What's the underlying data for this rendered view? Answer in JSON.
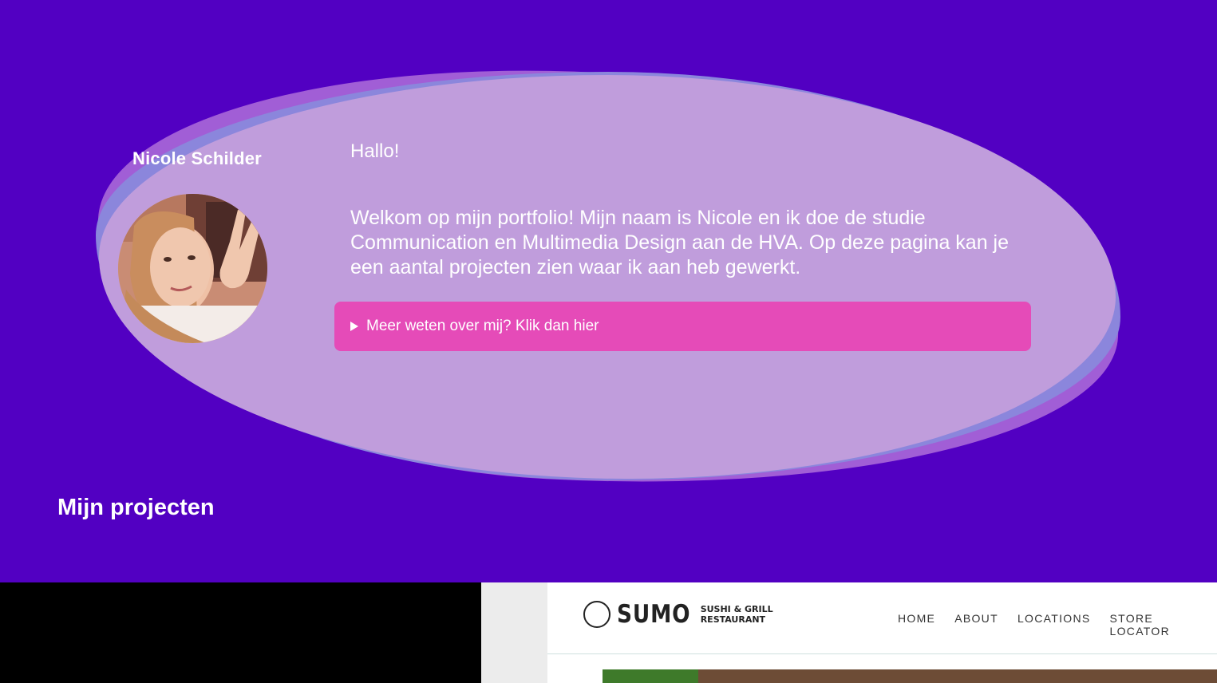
{
  "profile": {
    "name": "Nicole Schilder"
  },
  "intro": {
    "greeting": "Hallo!",
    "text": "Welkom op mijn portfolio! Mijn naam is Nicole en ik doe de studie Communication en Multimedia Design aan de HVA. Op deze pagina kan je een aantal projecten zien waar ik aan heb gewerkt.",
    "more_button": "Meer weten over mij? Klik dan hier"
  },
  "projects": {
    "title": "Mijn projecten",
    "sumo": {
      "brand": "SUMO",
      "brand_sub_1": "SUSHI & GRILL",
      "brand_sub_2": "RESTAURANT",
      "nav": [
        "HOME",
        "ABOUT",
        "LOCATIONS",
        "STORE LOCATOR"
      ]
    }
  },
  "colors": {
    "background": "#5200c2",
    "blob": "#c09ddc",
    "button": "#e54bb8"
  }
}
